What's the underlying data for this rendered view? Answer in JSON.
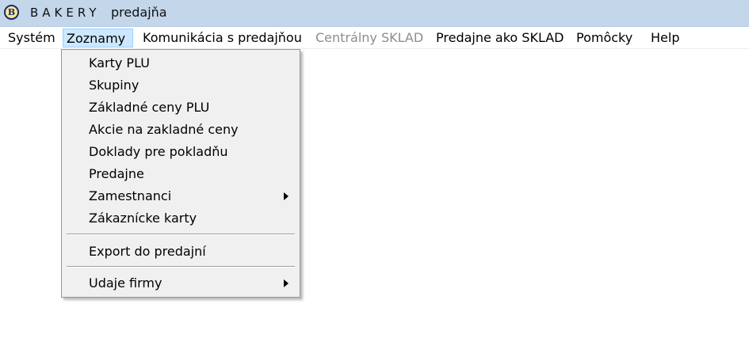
{
  "window": {
    "logo_letter": "B",
    "app_name": "BAKERY",
    "title": "predajňa"
  },
  "menubar": {
    "items": [
      {
        "label": "Systém",
        "disabled": false
      },
      {
        "label": "Zoznamy",
        "disabled": false,
        "open": true
      },
      {
        "label": "Komunikácia s predajňou",
        "disabled": false
      },
      {
        "label": "Centrálny SKLAD",
        "disabled": true
      },
      {
        "label": "Predajne ako SKLAD",
        "disabled": false
      },
      {
        "label": "Pomôcky",
        "disabled": false
      },
      {
        "label": "Help",
        "disabled": false
      }
    ]
  },
  "dropdown": {
    "items": [
      {
        "label": "Karty PLU"
      },
      {
        "label": "Skupiny"
      },
      {
        "label": "Základné ceny PLU"
      },
      {
        "label": "Akcie na zakladné ceny"
      },
      {
        "label": "Doklady pre pokladňu"
      },
      {
        "label": "Predajne"
      },
      {
        "label": "Zamestnanci",
        "submenu": true
      },
      {
        "label": "Zákaznícke karty"
      },
      {
        "label": "Export do predajní"
      },
      {
        "label": "Udaje firmy",
        "submenu": true
      }
    ]
  },
  "colors": {
    "titlebar_bg": "#c3d6ea",
    "menu_open_highlight": "#cce8ff",
    "disabled_text": "#8d8d8d",
    "dropdown_bg": "#f0f0f0"
  }
}
